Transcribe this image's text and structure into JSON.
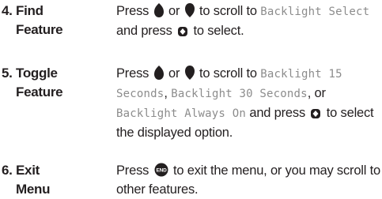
{
  "steps": [
    {
      "number": "4.",
      "title_line1": "Find",
      "title_line2": "Feature",
      "parts": {
        "p1": "Press",
        "p2": "or",
        "p3": "to scroll to",
        "lcd1": "Backlight Select",
        "p4": "and press",
        "p5": "to select."
      },
      "icons": [
        "scroll-up-key-icon",
        "scroll-down-key-icon",
        "select-key-icon"
      ]
    },
    {
      "number": "5.",
      "title_line1": "Toggle",
      "title_line2": "Feature",
      "parts": {
        "p1": "Press",
        "p2": "or",
        "p3": "to scroll to",
        "lcd1": "Backlight 15 Seconds",
        "p4": ",",
        "lcd2": "Backlight 30 Seconds",
        "p5": ", or",
        "lcd3": "Backlight Always On",
        "p6": "and press",
        "p7": "to select the displayed option."
      },
      "icons": [
        "scroll-up-key-icon",
        "scroll-down-key-icon",
        "select-key-icon"
      ]
    },
    {
      "number": "6.",
      "title_line1": "Exit",
      "title_line2": "Menu",
      "parts": {
        "p1": "Press",
        "p2": "to exit the menu, or you may scroll to other features."
      },
      "end_key_label": "END",
      "icons": [
        "end-key-icon"
      ]
    }
  ]
}
